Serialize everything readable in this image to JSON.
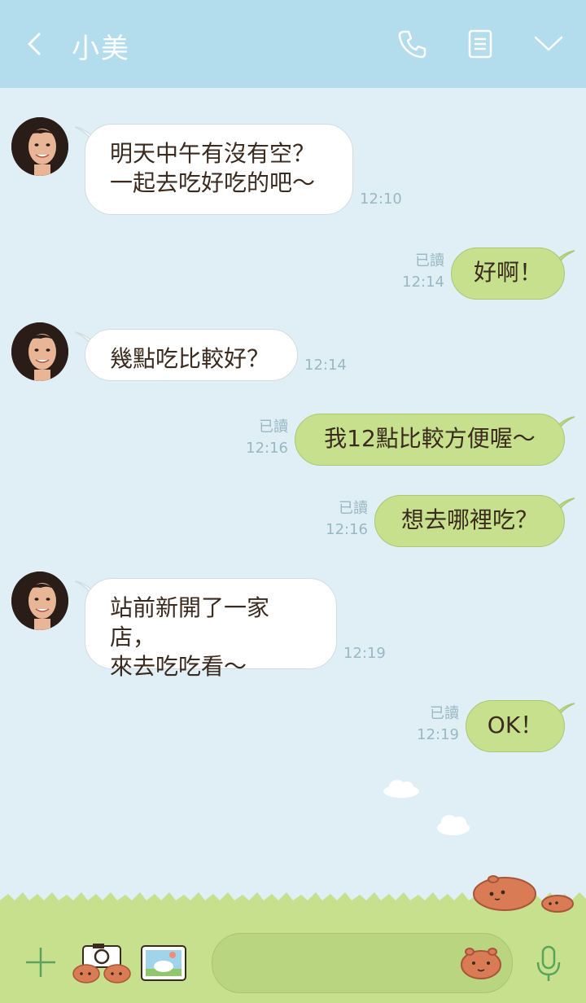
{
  "header": {
    "title": "小美",
    "back_icon": "chevron-left-icon",
    "call_icon": "phone-icon",
    "notes_icon": "notes-icon",
    "menu_icon": "chevron-down-icon"
  },
  "messages": [
    {
      "dir": "in",
      "text": "明天中午有沒有空？\n一起去吃好吃的吧～",
      "time": "12:10"
    },
    {
      "dir": "out",
      "text": "好啊！",
      "read": "已讀",
      "time": "12:14"
    },
    {
      "dir": "in",
      "text": "幾點吃比較好？",
      "time": "12:14"
    },
    {
      "dir": "out",
      "text": "我12點比較方便喔～",
      "read": "已讀",
      "time": "12:16"
    },
    {
      "dir": "out",
      "text": "想去哪裡吃？",
      "read": "已讀",
      "time": "12:16"
    },
    {
      "dir": "in",
      "text": "站前新開了一家店，\n來去吃吃看～",
      "time": "12:19"
    },
    {
      "dir": "out",
      "text": "OK！",
      "read": "已讀",
      "time": "12:19"
    }
  ],
  "footer": {
    "add_icon": "plus-icon",
    "camera_icon": "camera-icon",
    "photo_icon": "photo-icon",
    "sticker_icon": "sticker-icon",
    "mic_icon": "microphone-icon",
    "input_value": ""
  },
  "colors": {
    "header": "#b3dcec",
    "chat_bg": "#dfeff5",
    "out_bubble": "#c6e08d",
    "in_bubble": "#ffffff",
    "footer": "#c6e08d",
    "grass": "#c6e08d"
  }
}
